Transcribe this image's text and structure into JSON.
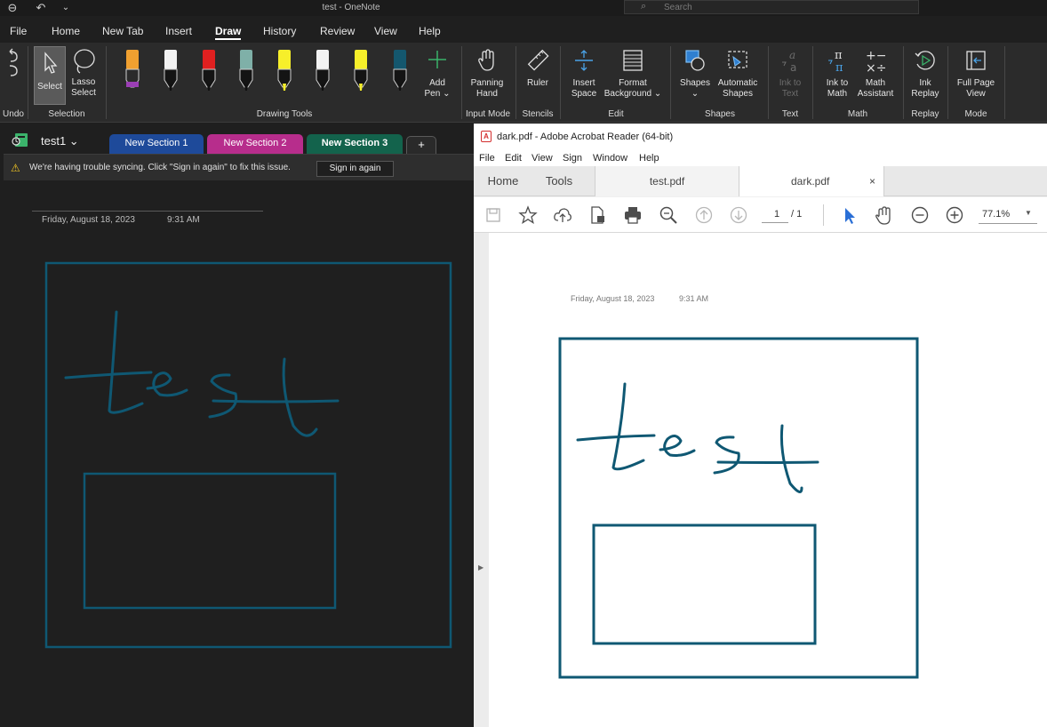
{
  "onenote": {
    "title": "test - OneNote",
    "search_placeholder": "Search",
    "menu_tabs": [
      "File",
      "Home",
      "New Tab",
      "Insert",
      "Draw",
      "History",
      "Review",
      "View",
      "Help"
    ],
    "active_menu_tab": "Draw",
    "ribbon": {
      "groups": {
        "undo": "Undo",
        "selection": "Selection",
        "drawing_tools": "Drawing Tools",
        "input_mode": "Input Mode",
        "stencils": "Stencils",
        "edit": "Edit",
        "shapes": "Shapes",
        "text": "Text",
        "math": "Math",
        "replay": "Replay",
        "mode": "Mode"
      },
      "buttons": {
        "select": "Select",
        "lasso_1": "Lasso",
        "lasso_2": "Select",
        "add_pen_1": "Add",
        "add_pen_2": "Pen ⌄",
        "panning_1": "Panning",
        "panning_2": "Hand",
        "ruler": "Ruler",
        "insert_space_1": "Insert",
        "insert_space_2": "Space",
        "format_bg_1": "Format",
        "format_bg_2": "Background ⌄",
        "shapes_1": "Shapes",
        "shapes_2": "⌄",
        "auto_shapes_1": "Automatic",
        "auto_shapes_2": "Shapes",
        "ink_text_1": "Ink to",
        "ink_text_2": "Text",
        "ink_math_1": "Ink to",
        "ink_math_2": "Math",
        "math_asst_1": "Math",
        "math_asst_2": "Assistant",
        "ink_replay_1": "Ink",
        "ink_replay_2": "Replay",
        "full_page_1": "Full Page",
        "full_page_2": "View"
      },
      "pens": [
        {
          "color": "#f0a030",
          "tip": "#9b3fb5"
        },
        {
          "color": "#f2f2f2",
          "tip": "#111111"
        },
        {
          "color": "#e02020",
          "tip": "#111111"
        },
        {
          "color": "#7fb0a8",
          "tip": "#111111"
        },
        {
          "color": "#f7ef2a",
          "tip": "#f7ef2a"
        },
        {
          "color": "#f2f2f2",
          "tip": "#111111"
        },
        {
          "color": "#f7ef2a",
          "tip": "#f7ef2a"
        },
        {
          "color": "#14576e",
          "tip": "#111111"
        }
      ]
    },
    "notebook_name": "test1 ⌄",
    "sections": [
      {
        "label": "New Section 1",
        "color": "#1e4a9a",
        "active": false
      },
      {
        "label": "New Section 2",
        "color": "#b72d8c",
        "active": false
      },
      {
        "label": "New Section 3",
        "color": "#13634c",
        "active": true
      }
    ],
    "add_section": "+",
    "sync_message": "We're having trouble syncing. Click \"Sign in again\" to fix this issue.",
    "sign_in_label": "Sign in again",
    "page_date": "Friday, August 18, 2023",
    "page_time": "9:31 AM",
    "ink_color": "#0f5873",
    "handwriting": "test"
  },
  "acrobat": {
    "window_title": "dark.pdf - Adobe Acrobat Reader (64-bit)",
    "menu": [
      "File",
      "Edit",
      "View",
      "Sign",
      "Window",
      "Help"
    ],
    "tabs": {
      "home": "Home",
      "tools": "Tools",
      "doc1": "test.pdf",
      "doc2": "dark.pdf",
      "close": "×"
    },
    "page_current": "1",
    "page_total": "/ 1",
    "zoom": "77.1%",
    "pdf_date": "Friday, August 18, 2023",
    "pdf_time": "9:31 AM",
    "ink_color": "#0f5873",
    "handwriting": "test"
  }
}
